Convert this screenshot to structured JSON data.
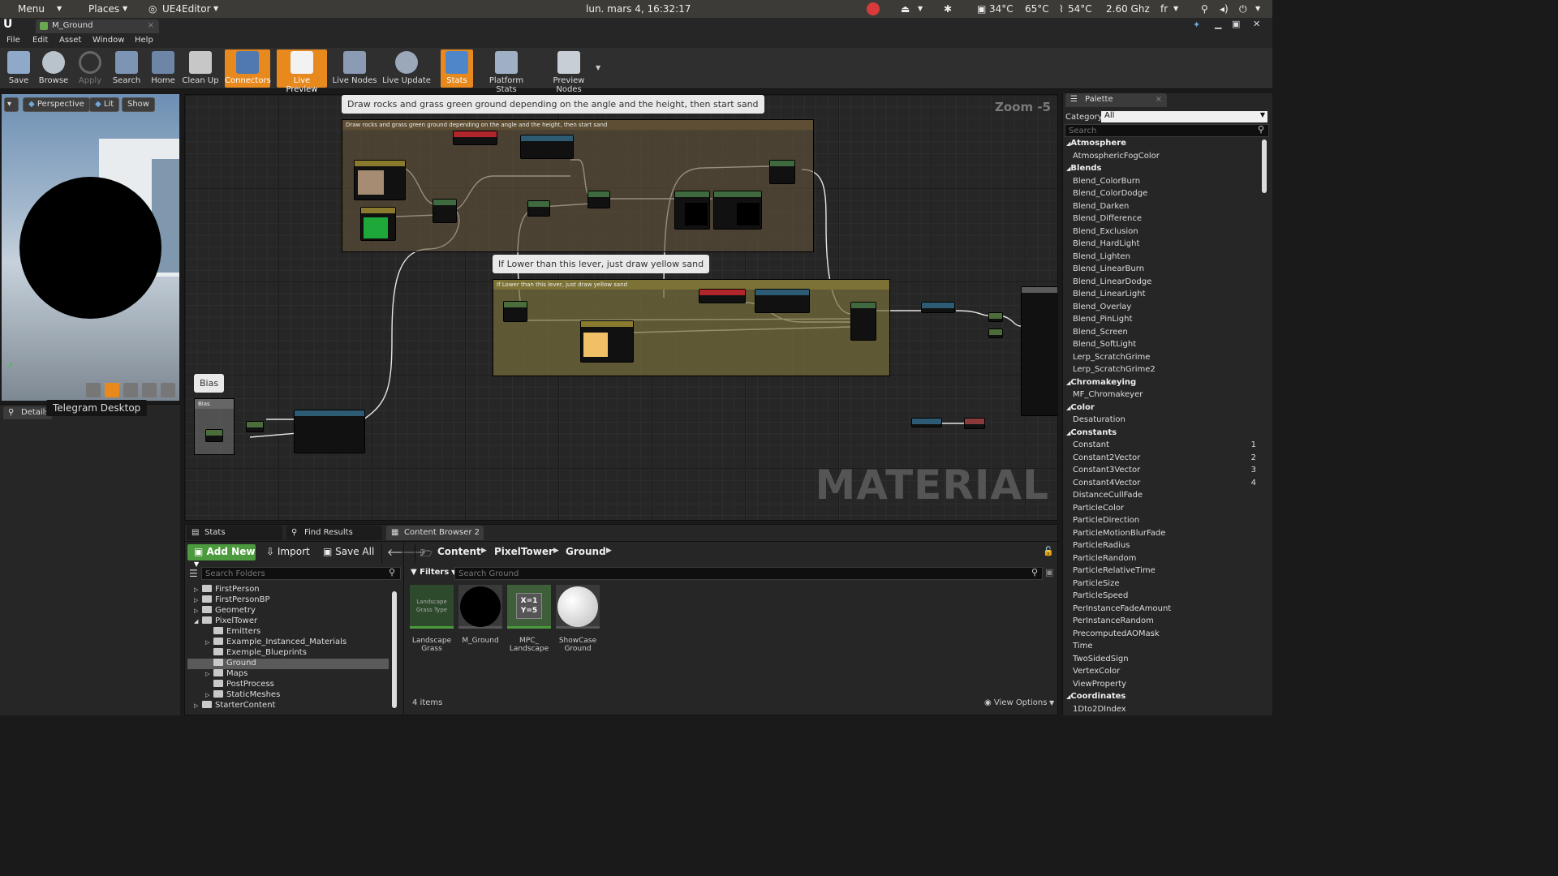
{
  "os_bar": {
    "menu": "Menu",
    "places": "Places",
    "app": "UE4Editor",
    "clock": "lun. mars  4, 16:32:17",
    "temp1": "34°C",
    "temp2": "65°C",
    "temp3": "54°C",
    "freq": "2.60 Ghz",
    "lang": "fr"
  },
  "window": {
    "tab_title": "M_Ground"
  },
  "menubar": [
    "File",
    "Edit",
    "Asset",
    "Window",
    "Help"
  ],
  "toolbar": [
    {
      "label": "Save",
      "icon": "save-icon"
    },
    {
      "label": "Browse",
      "icon": "browse-icon"
    },
    {
      "label": "Apply",
      "icon": "apply-icon"
    },
    {
      "label": "Search",
      "icon": "search-icon"
    },
    {
      "label": "Home",
      "icon": "home-icon"
    },
    {
      "label": "Clean Up",
      "icon": "cleanup-icon"
    },
    {
      "label": "Connectors",
      "icon": "connectors-icon"
    },
    {
      "label": "Live Preview",
      "icon": "live-preview-icon"
    },
    {
      "label": "Live Nodes",
      "icon": "live-nodes-icon"
    },
    {
      "label": "Live Update",
      "icon": "live-update-icon"
    },
    {
      "label": "Stats",
      "icon": "stats-icon"
    },
    {
      "label": "Platform Stats",
      "icon": "platform-stats-icon"
    },
    {
      "label": "Preview Nodes",
      "icon": "preview-nodes-icon"
    }
  ],
  "viewport": {
    "perspective": "Perspective",
    "lit": "Lit",
    "show": "Show"
  },
  "details_tab": "Details",
  "tooltip": "Telegram Desktop",
  "graph": {
    "zoom": "Zoom -5",
    "watermark": "MATERIAL",
    "comment1": "Draw rocks and grass green ground depending on the angle and the height, then start sand",
    "comment2": "If Lower than this lever, just draw yellow sand",
    "comment3": "Bias"
  },
  "palette": {
    "tab": "Palette",
    "category_label": "Category:",
    "category_value": "All",
    "search_placeholder": "Search",
    "items": [
      {
        "t": "Atmosphere",
        "cat": true
      },
      {
        "t": "AtmosphericFogColor"
      },
      {
        "t": "Blends",
        "cat": true
      },
      {
        "t": "Blend_ColorBurn"
      },
      {
        "t": "Blend_ColorDodge"
      },
      {
        "t": "Blend_Darken"
      },
      {
        "t": "Blend_Difference"
      },
      {
        "t": "Blend_Exclusion"
      },
      {
        "t": "Blend_HardLight"
      },
      {
        "t": "Blend_Lighten"
      },
      {
        "t": "Blend_LinearBurn"
      },
      {
        "t": "Blend_LinearDodge"
      },
      {
        "t": "Blend_LinearLight"
      },
      {
        "t": "Blend_Overlay"
      },
      {
        "t": "Blend_PinLight"
      },
      {
        "t": "Blend_Screen"
      },
      {
        "t": "Blend_SoftLight"
      },
      {
        "t": "Lerp_ScratchGrime"
      },
      {
        "t": "Lerp_ScratchGrime2"
      },
      {
        "t": "Chromakeying",
        "cat": true
      },
      {
        "t": "MF_Chromakeyer"
      },
      {
        "t": "Color",
        "cat": true
      },
      {
        "t": "Desaturation"
      },
      {
        "t": "Constants",
        "cat": true
      },
      {
        "t": "Constant",
        "n": "1"
      },
      {
        "t": "Constant2Vector",
        "n": "2"
      },
      {
        "t": "Constant3Vector",
        "n": "3"
      },
      {
        "t": "Constant4Vector",
        "n": "4"
      },
      {
        "t": "DistanceCullFade"
      },
      {
        "t": "ParticleColor"
      },
      {
        "t": "ParticleDirection"
      },
      {
        "t": "ParticleMotionBlurFade"
      },
      {
        "t": "ParticleRadius"
      },
      {
        "t": "ParticleRandom"
      },
      {
        "t": "ParticleRelativeTime"
      },
      {
        "t": "ParticleSize"
      },
      {
        "t": "ParticleSpeed"
      },
      {
        "t": "PerInstanceFadeAmount"
      },
      {
        "t": "PerInstanceRandom"
      },
      {
        "t": "PrecomputedAOMask"
      },
      {
        "t": "Time"
      },
      {
        "t": "TwoSidedSign"
      },
      {
        "t": "VertexColor"
      },
      {
        "t": "ViewProperty"
      },
      {
        "t": "Coordinates",
        "cat": true
      },
      {
        "t": "1Dto2DIndex"
      }
    ]
  },
  "bottom": {
    "tabs": [
      "Stats",
      "Find Results",
      "Content Browser 2"
    ],
    "add_new": "Add New",
    "import": "Import",
    "save_all": "Save All",
    "breadcrumb": [
      "Content",
      "PixelTower",
      "Ground"
    ],
    "search_folders": "Search Folders",
    "filters": "Filters",
    "search_assets": "Search Ground",
    "folders": [
      {
        "name": "FirstPerson",
        "depth": 0,
        "exp": true
      },
      {
        "name": "FirstPersonBP",
        "depth": 0,
        "exp": true
      },
      {
        "name": "Geometry",
        "depth": 0,
        "exp": true
      },
      {
        "name": "PixelTower",
        "depth": 0,
        "exp": true,
        "open": true
      },
      {
        "name": "Emitters",
        "depth": 1
      },
      {
        "name": "Example_Instanced_Materials",
        "depth": 1,
        "exp": true
      },
      {
        "name": "Exemple_Blueprints",
        "depth": 1
      },
      {
        "name": "Ground",
        "depth": 1,
        "sel": true
      },
      {
        "name": "Maps",
        "depth": 1,
        "exp": true
      },
      {
        "name": "PostProcess",
        "depth": 1
      },
      {
        "name": "StaticMeshes",
        "depth": 1,
        "exp": true
      },
      {
        "name": "StarterContent",
        "depth": 0,
        "exp": true
      }
    ],
    "assets": [
      {
        "name": "Landscape Grass",
        "thumb": "Landscape Grass Type"
      },
      {
        "name": "M_Ground",
        "thumb": ""
      },
      {
        "name": "MPC_ Landscape",
        "thumb": "X=1 Y=5"
      },
      {
        "name": "ShowCase Ground",
        "thumb": ""
      }
    ],
    "count": "4 items",
    "view_options": "View Options"
  }
}
